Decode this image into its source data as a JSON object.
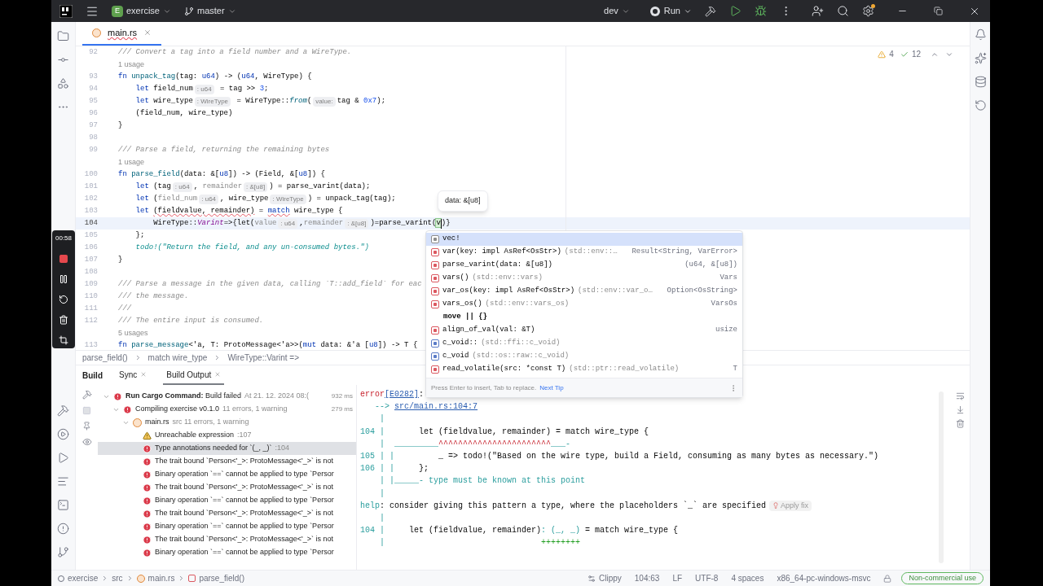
{
  "title_bar": {
    "project_badge": "E",
    "project": "exercise",
    "branch": "master",
    "run_config": "dev",
    "run_label": "Run"
  },
  "recorder": {
    "time": "00:58"
  },
  "editor": {
    "tab": {
      "label": "main.rs",
      "selected": true
    },
    "inspections": {
      "warnings": "4",
      "weak_warnings": "12"
    },
    "lines": [
      {
        "kind": "code",
        "number": "92",
        "tokens": [
          {
            "kind": "comment",
            "text": "/// Convert a tag into a field number and a WireType."
          }
        ]
      },
      {
        "kind": "usage",
        "text": "1 usage"
      },
      {
        "kind": "code",
        "number": "93",
        "tokens": [
          {
            "kind": "kw",
            "text": "fn "
          },
          {
            "kind": "def",
            "text": "unpack_tag"
          },
          {
            "kind": "plain",
            "text": "(tag: "
          },
          {
            "kind": "type",
            "text": "u64"
          },
          {
            "kind": "plain",
            "text": ") -> ("
          },
          {
            "kind": "type",
            "text": "u64"
          },
          {
            "kind": "plain",
            "text": ", WireType) {"
          }
        ]
      },
      {
        "kind": "code",
        "number": "94",
        "tokens": [
          {
            "kind": "kw",
            "text": "    let "
          },
          {
            "kind": "plain",
            "text": "field_num"
          },
          {
            "kind": "hint",
            "text": ": u64"
          },
          {
            "kind": "plain",
            "text": " = tag >> "
          },
          {
            "kind": "num",
            "text": "3"
          },
          {
            "kind": "plain",
            "text": ";"
          }
        ]
      },
      {
        "kind": "code",
        "number": "95",
        "tokens": [
          {
            "kind": "kw",
            "text": "    let "
          },
          {
            "kind": "plain",
            "text": "wire_type"
          },
          {
            "kind": "hint",
            "text": ": WireType"
          },
          {
            "kind": "plain",
            "text": " = WireType::"
          },
          {
            "kind": "call",
            "text": "from"
          },
          {
            "kind": "plain",
            "text": "("
          },
          {
            "kind": "hint",
            "text": "value:"
          },
          {
            "kind": "plain",
            "text": "tag & "
          },
          {
            "kind": "num",
            "text": "0x7"
          },
          {
            "kind": "plain",
            "text": ");"
          }
        ]
      },
      {
        "kind": "code",
        "number": "96",
        "tokens": [
          {
            "kind": "plain",
            "text": "    (field_num, wire_type)"
          }
        ]
      },
      {
        "kind": "code",
        "number": "97",
        "tokens": [
          {
            "kind": "plain",
            "text": "}"
          }
        ]
      },
      {
        "kind": "code",
        "number": "98"
      },
      {
        "kind": "code",
        "number": "99",
        "tokens": [
          {
            "kind": "comment",
            "text": "/// Parse a field, returning the remaining bytes"
          }
        ]
      },
      {
        "kind": "usage",
        "text": "1 usage"
      },
      {
        "kind": "code",
        "number": "100",
        "tokens": [
          {
            "kind": "kw",
            "text": "fn "
          },
          {
            "kind": "def",
            "text": "parse_field"
          },
          {
            "kind": "plain",
            "text": "(data: &["
          },
          {
            "kind": "type",
            "text": "u8"
          },
          {
            "kind": "plain",
            "text": "]) -> (Field, &["
          },
          {
            "kind": "type",
            "text": "u8"
          },
          {
            "kind": "plain",
            "text": "]) {"
          }
        ]
      },
      {
        "kind": "code",
        "number": "101",
        "tokens": [
          {
            "kind": "kw",
            "text": "    let "
          },
          {
            "kind": "plain",
            "text": "(tag"
          },
          {
            "kind": "hint",
            "text": ": u64"
          },
          {
            "kind": "plain",
            "text": ", "
          },
          {
            "kind": "dim",
            "text": "remainder"
          },
          {
            "kind": "hint",
            "text": ": &[u8]"
          },
          {
            "kind": "plain",
            "text": ") = parse_varint(data);"
          }
        ]
      },
      {
        "kind": "code",
        "number": "102",
        "tokens": [
          {
            "kind": "kw",
            "text": "    let "
          },
          {
            "kind": "plain",
            "text": "("
          },
          {
            "kind": "dim",
            "text": "field_num"
          },
          {
            "kind": "hint",
            "text": ": u64"
          },
          {
            "kind": "plain",
            "text": ", wire_type"
          },
          {
            "kind": "hint",
            "text": ": WireType"
          },
          {
            "kind": "plain",
            "text": ") = unpack_tag(tag);"
          }
        ]
      },
      {
        "kind": "code",
        "number": "103",
        "tokens": [
          {
            "kind": "kw",
            "text": "    let "
          },
          {
            "kind": "err",
            "text": "(fieldvalue, remainder)"
          },
          {
            "kind": "plain",
            "text": " = "
          },
          {
            "kind": "errkw",
            "text": "match"
          },
          {
            "kind": "plain",
            "text": " wire_type {"
          }
        ]
      },
      {
        "kind": "code",
        "number": "104",
        "current": true,
        "tokens": [
          {
            "kind": "plain",
            "text": "        WireType::"
          },
          {
            "kind": "variant",
            "text": "Varint"
          },
          {
            "kind": "plain",
            "text": "=>{let("
          },
          {
            "kind": "dim",
            "text": "value"
          },
          {
            "kind": "hint",
            "text": ": u64"
          },
          {
            "kind": "plain",
            "text": ","
          },
          {
            "kind": "dim",
            "text": "remainder"
          },
          {
            "kind": "hint",
            "text": ": &[u8]"
          },
          {
            "kind": "plain",
            "text": ")=parse_varint("
          },
          {
            "kind": "typed",
            "text": "v"
          },
          {
            "kind": "plain",
            "text": ")}"
          }
        ]
      },
      {
        "kind": "code",
        "number": "105",
        "tokens": [
          {
            "kind": "plain",
            "text": "    };"
          }
        ]
      },
      {
        "kind": "code",
        "number": "106",
        "tokens": [
          {
            "kind": "macro",
            "text": "    todo!"
          },
          {
            "kind": "str",
            "text": "(\"Return the field, and any un-consumed bytes.\")"
          }
        ]
      },
      {
        "kind": "code",
        "number": "107",
        "tokens": [
          {
            "kind": "plain",
            "text": "}"
          }
        ]
      },
      {
        "kind": "code",
        "number": "108"
      },
      {
        "kind": "code",
        "number": "109",
        "tokens": [
          {
            "kind": "comment",
            "text": "/// Parse a message in the given data, calling `T::add_field` for eac"
          }
        ]
      },
      {
        "kind": "code",
        "number": "110",
        "tokens": [
          {
            "kind": "comment",
            "text": "/// the message."
          }
        ]
      },
      {
        "kind": "code",
        "number": "111",
        "tokens": [
          {
            "kind": "comment",
            "text": "///"
          }
        ]
      },
      {
        "kind": "code",
        "number": "112",
        "tokens": [
          {
            "kind": "comment",
            "text": "/// The entire input is consumed."
          }
        ]
      },
      {
        "kind": "usage",
        "text": "5 usages"
      },
      {
        "kind": "code",
        "number": "113",
        "tokens": [
          {
            "kind": "kw",
            "text": "fn "
          },
          {
            "kind": "def",
            "text": "parse_message"
          },
          {
            "kind": "plain",
            "text": "<'a, T: ProtoMessage<'a>>("
          },
          {
            "kind": "kw",
            "text": "mut "
          },
          {
            "kind": "plain",
            "text": "data: &'a ["
          },
          {
            "kind": "type",
            "text": "u8"
          },
          {
            "kind": "plain",
            "text": "]) -> T {"
          }
        ]
      }
    ],
    "tooltip": "data: &[u8]",
    "completion": {
      "items": [
        {
          "kind": "macro",
          "name": "vec!",
          "selected": true
        },
        {
          "kind": "function",
          "name": "var(key: impl AsRef<OsStr>)",
          "location": "(std::env::…",
          "type": "Result<String, VarError>",
          "selected": false
        },
        {
          "kind": "function",
          "name": "parse_varint(data: &[u8])",
          "type": "(u64, &[u8])",
          "selected": false
        },
        {
          "kind": "function",
          "name": "vars()",
          "location": "(std::env::vars)",
          "type": "Vars",
          "selected": false
        },
        {
          "kind": "function",
          "name": "var_os(key: impl AsRef<OsStr>)",
          "location": "(std::env::var_o…",
          "type": "Option<OsString>",
          "selected": false
        },
        {
          "kind": "function",
          "name": "vars_os()",
          "location": "(std::env::vars_os)",
          "type": "VarsOs",
          "selected": false
        },
        {
          "kind": "keyword",
          "name": "move || {}",
          "selected": false
        },
        {
          "kind": "function",
          "name": "align_of_val(val: &T)",
          "type": "usize",
          "selected": false
        },
        {
          "kind": "enum",
          "name": "c_void::",
          "location": "(std::ffi::c_void)",
          "selected": false
        },
        {
          "kind": "enum",
          "name": "c_void",
          "location": "(std::os::raw::c_void)",
          "selected": false
        },
        {
          "kind": "function",
          "name": "read_volatile(src: *const T)",
          "location": "(std::ptr::read_volatile)",
          "type": "T",
          "selected": false
        }
      ],
      "footer": "Press Enter to insert, Tab to replace.",
      "tip_link": "Next Tip"
    },
    "breadcrumbs": [
      "parse_field()",
      "match wire_type",
      "WireType::Varint =>"
    ]
  },
  "build": {
    "title": "Build",
    "tabs": [
      {
        "label": "Sync",
        "selected": false
      },
      {
        "label": "Build Output",
        "selected": true
      }
    ],
    "tree": [
      {
        "kind": "error",
        "title": "**Run Cargo Command:** Build failed",
        "detail": "At 21. 12. 2024 08:(",
        "time": "932 ms",
        "expanded": true,
        "selected": false,
        "children": [
          {
            "kind": "error",
            "title": "Compiling exercise v0.1.0",
            "detail": "11 errors, 1 warning",
            "time": "279 ms",
            "expanded": true,
            "selected": false,
            "children": [
              {
                "kind": "file",
                "title": "main.rs",
                "detail": "src 11 errors, 1 warning",
                "expanded": true,
                "selected": false,
                "children": [
                  {
                    "kind": "warning",
                    "title": "Unreachable expression",
                    "detail": ":107",
                    "selected": false
                  },
                  {
                    "kind": "error",
                    "title": "Type annotations needed for `(_, _)`",
                    "detail": ":104",
                    "selected": true
                  },
                  {
                    "kind": "error",
                    "title": "The trait bound `Person<'_>: ProtoMessage<'_>` is not",
                    "selected": false
                  },
                  {
                    "kind": "error",
                    "title": "Binary operation `==` cannot be applied to type `Persor",
                    "selected": false
                  },
                  {
                    "kind": "error",
                    "title": "The trait bound `Person<'_>: ProtoMessage<'_>` is not",
                    "selected": false
                  },
                  {
                    "kind": "error",
                    "title": "Binary operation `==` cannot be applied to type `Persor",
                    "selected": false
                  },
                  {
                    "kind": "error",
                    "title": "The trait bound `Person<'_>: ProtoMessage<'_>` is not",
                    "selected": false
                  },
                  {
                    "kind": "error",
                    "title": "Binary operation `==` cannot be applied to type `Persor",
                    "selected": false
                  },
                  {
                    "kind": "error",
                    "title": "The trait bound `Person<'_>: ProtoMessage<'_>` is not",
                    "selected": false
                  },
                  {
                    "kind": "error",
                    "title": "Binary operation `==` cannot be applied to type `Persor",
                    "selected": false
                  }
                ]
              }
            ]
          }
        ]
      }
    ],
    "output": [
      [
        {
          "kind": "red",
          "text": "error"
        },
        {
          "kind": "link",
          "text": "[E0282]"
        },
        {
          "kind": "plain",
          "text": ":"
        }
      ],
      [
        {
          "kind": "gut",
          "text": "   --> "
        },
        {
          "kind": "link",
          "text": "src/main.rs:104:7"
        }
      ],
      [
        {
          "kind": "gut",
          "text": "    |"
        }
      ],
      [
        {
          "kind": "gut",
          "text": "104 |"
        },
        {
          "kind": "plain",
          "text": "       let (fieldvalue, remainder) = match wire_type {"
        }
      ],
      [
        {
          "kind": "gut",
          "text": "    |  _________"
        },
        {
          "kind": "red",
          "text": "^^^^^^^^^^^^^^^^^^^^^^^"
        },
        {
          "kind": "gut",
          "text": "___-"
        }
      ],
      [
        {
          "kind": "gut",
          "text": "105 | |"
        },
        {
          "kind": "plain",
          "text": "         _ => todo!(\"Based on the wire type, build a Field, consuming as many bytes as necessary.\")"
        }
      ],
      [
        {
          "kind": "gut",
          "text": "106 | |"
        },
        {
          "kind": "plain",
          "text": "     };"
        }
      ],
      [
        {
          "kind": "gut",
          "text": "    | |_____- type must be known at this point"
        }
      ],
      [
        {
          "kind": "gut",
          "text": "    |"
        }
      ],
      [
        {
          "kind": "gut",
          "text": "help"
        },
        {
          "kind": "plain",
          "text": ": consider giving this pattern a type, where the placeholders `_` are specified"
        },
        {
          "kind": "fix",
          "text": "Apply fix"
        }
      ],
      [
        {
          "kind": "gut",
          "text": "    |"
        }
      ],
      [
        {
          "kind": "gut",
          "text": "104 |"
        },
        {
          "kind": "plain",
          "text": "     let (fieldvalue, remainder)"
        },
        {
          "kind": "gut",
          "text": ": (_, _)"
        },
        {
          "kind": "plain",
          "text": " = match wire_type {"
        }
      ],
      [
        {
          "kind": "gut",
          "text": "    |"
        },
        {
          "kind": "add",
          "text": "                                ++++++++"
        }
      ]
    ]
  },
  "status_bar": {
    "path": [
      {
        "kind": "project",
        "text": "exercise"
      },
      {
        "kind": "folder",
        "text": "src"
      },
      {
        "kind": "rust",
        "text": "main.rs"
      },
      {
        "kind": "function",
        "text": "parse_field()"
      }
    ],
    "linter": "Clippy",
    "items": [
      "104:63",
      "LF",
      "UTF-8",
      "4 spaces",
      "x86_64-pc-windows-msvc"
    ],
    "license": "Non-commercial use"
  }
}
